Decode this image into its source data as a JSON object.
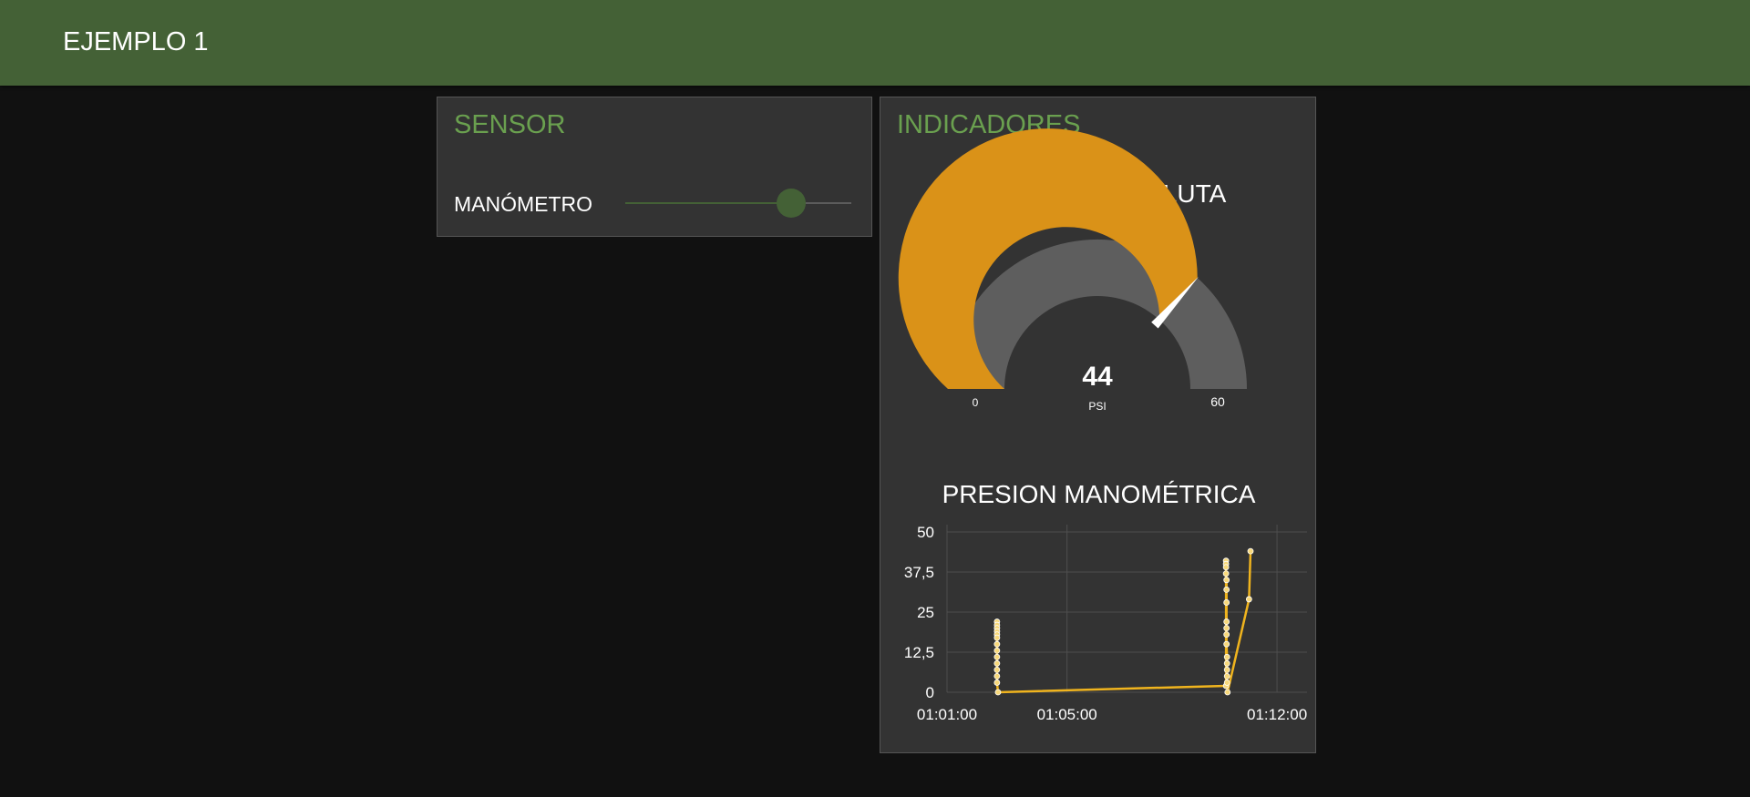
{
  "header": {
    "title": "EJEMPLO 1"
  },
  "sensor_group": {
    "title": "SENSOR",
    "slider": {
      "label": "MANÓMETRO",
      "min": 0,
      "max": 60,
      "value": 44
    }
  },
  "indicators_group": {
    "title": "INDICADORES",
    "gauge": {
      "title": "PRESIÓN ABSOLUTA",
      "value": "44",
      "units": "PSI",
      "min_label": "0",
      "max_label": "60",
      "min": 0,
      "max": 60,
      "level": 44
    },
    "chart_title": "PRESION MANOMÉTRICA"
  },
  "colors": {
    "header": "#446136",
    "group_title": "#6aa04f",
    "gauge_fill": "#da9218",
    "gauge_rest": "#5e5e5e",
    "series_line": "#f0b41e",
    "panel": "#333333",
    "background": "#111111"
  },
  "chart_data": {
    "type": "line",
    "title": "PRESION MANOMÉTRICA",
    "xlabel": "",
    "ylabel": "",
    "ylim": [
      0,
      50
    ],
    "y_ticks": [
      "0",
      "12,5",
      "25",
      "37,5",
      "50"
    ],
    "x_tick_labels": [
      "01:01:00",
      "01:05:00",
      "01:12:00"
    ],
    "x_tick_seconds": [
      3660,
      3900,
      4320
    ],
    "xlim_seconds": [
      3660,
      4380
    ],
    "grid": true,
    "legend": "none",
    "series": [
      {
        "points": [
          {
            "t": 3760,
            "v": 22
          },
          {
            "t": 3760,
            "v": 21
          },
          {
            "t": 3760,
            "v": 20
          },
          {
            "t": 3760,
            "v": 19
          },
          {
            "t": 3760,
            "v": 18
          },
          {
            "t": 3760,
            "v": 17
          },
          {
            "t": 3760,
            "v": 15
          },
          {
            "t": 3760,
            "v": 13
          },
          {
            "t": 3760,
            "v": 11
          },
          {
            "t": 3760,
            "v": 9
          },
          {
            "t": 3760,
            "v": 7
          },
          {
            "t": 3760,
            "v": 5
          },
          {
            "t": 3760,
            "v": 3
          },
          {
            "t": 3762,
            "v": 0
          },
          {
            "t": 4218,
            "v": 2
          },
          {
            "t": 4218,
            "v": 41
          },
          {
            "t": 4218,
            "v": 40
          },
          {
            "t": 4218,
            "v": 39
          },
          {
            "t": 4218,
            "v": 37
          },
          {
            "t": 4219,
            "v": 35
          },
          {
            "t": 4219,
            "v": 32
          },
          {
            "t": 4219,
            "v": 28
          },
          {
            "t": 4219,
            "v": 22
          },
          {
            "t": 4219,
            "v": 20
          },
          {
            "t": 4219,
            "v": 18
          },
          {
            "t": 4219,
            "v": 15
          },
          {
            "t": 4220,
            "v": 11
          },
          {
            "t": 4220,
            "v": 9
          },
          {
            "t": 4220,
            "v": 7
          },
          {
            "t": 4220,
            "v": 5
          },
          {
            "t": 4220,
            "v": 3
          },
          {
            "t": 4221,
            "v": 0
          },
          {
            "t": 4264,
            "v": 29
          },
          {
            "t": 4267,
            "v": 44
          }
        ]
      }
    ]
  }
}
